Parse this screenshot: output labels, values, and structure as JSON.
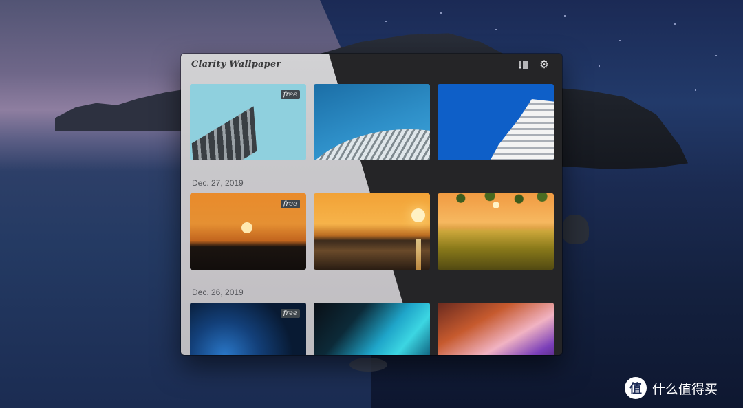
{
  "window": {
    "title": "Clarity Wallpaper",
    "sort_icon": "sort-icon",
    "settings_icon": "gear-icon"
  },
  "tag": "free",
  "groups": [
    {
      "date": "",
      "items": [
        "architecture-cyan",
        "architecture-waves",
        "architecture-fins"
      ]
    },
    {
      "date": "Dec. 27, 2019",
      "items": [
        "sunset-silhouette",
        "sunset-sea",
        "sunset-flower-field"
      ]
    },
    {
      "date": "Dec. 26, 2019",
      "items": [
        "abstract-blue",
        "abstract-teal",
        "abstract-purple"
      ]
    }
  ],
  "watermark": {
    "logo_char": "值",
    "text": "什么值得买"
  }
}
